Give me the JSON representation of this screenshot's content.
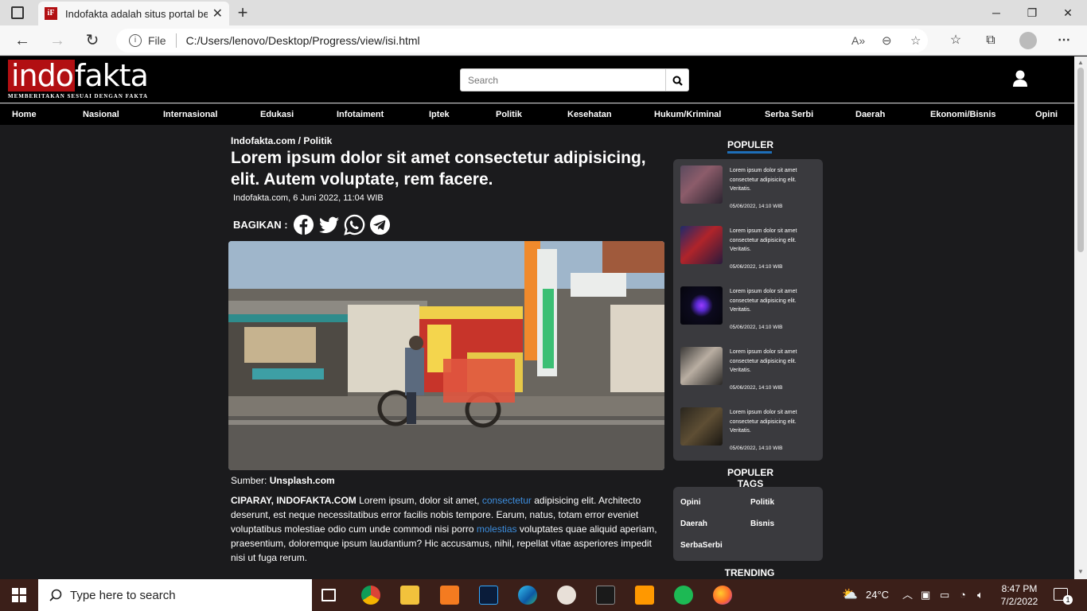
{
  "browser": {
    "tab_title": "Indofakta adalah situs portal beri",
    "url_prefix": "File",
    "url": "C:/Users/lenovo/Desktop/Progress/view/isi.html"
  },
  "site": {
    "logo_left": "indo",
    "logo_right": "fakta",
    "logo_tagline": "MEMBERITAKAN SESUAI DENGAN FAKTA",
    "search_placeholder": "Search",
    "nav": [
      "Home",
      "Nasional",
      "Internasional",
      "Edukasi",
      "Infotaiment",
      "Iptek",
      "Politik",
      "Kesehatan",
      "Hukum/Kriminal",
      "Serba Serbi",
      "Daerah",
      "Ekonomi/Bisnis",
      "Opini"
    ]
  },
  "article": {
    "breadcrumb": "Indofakta.com / Politik",
    "title": "Lorem ipsum dolor sit amet consectetur adipisicing, elit. Autem voluptate, rem facere.",
    "dateline": "Indofakta.com, 6 Juni 2022, 11:04 WIB",
    "share_label": "BAGIKAN :",
    "share_icons": [
      "facebook-icon",
      "twitter-icon",
      "whatsapp-icon",
      "telegram-icon"
    ],
    "source_label": "Sumber:",
    "source_value": "Unsplash.com",
    "body_lead": "CIPARAY, INDOFAKTA.COM",
    "body_1": " Lorem ipsum, dolor sit amet, ",
    "body_link_1": "consectetur",
    "body_2": " adipisicing elit. Architecto deserunt, est neque necessitatibus error facilis nobis tempore. Earum, natus, totam error eveniet voluptatibus molestiae odio cum unde commodi nisi porro ",
    "body_link_2": "molestias",
    "body_3": " voluptates quae aliquid aperiam, praesentium, doloremque ipsum laudantium? Hic accusamus, nihil, repellat vitae asperiores impedit nisi ut fuga rerum."
  },
  "sidebar": {
    "popular_title": "POPULER",
    "popular": [
      {
        "text": "Lorem ipsum dolor sit amet consectetur adipisicing elit. Veritatis.",
        "date": "05/06/2022, 14:10 WIB"
      },
      {
        "text": "Lorem ipsum dolor sit amet consectetur adipisicing elit. Veritatis.",
        "date": "05/06/2022, 14:10 WIB"
      },
      {
        "text": "Lorem ipsum dolor sit amet consectetur adipisicing elit. Veritatis.",
        "date": "05/06/2022, 14:10 WIB"
      },
      {
        "text": "Lorem ipsum dolor sit amet consectetur adipisicing elit. Veritatis.",
        "date": "05/06/2022, 14:10 WIB"
      },
      {
        "text": "Lorem ipsum dolor sit amet consectetur adipisicing elit. Veritatis.",
        "date": "05/06/2022, 14:10 WIB"
      }
    ],
    "tags_title": "POPULER TAGS",
    "tags": [
      "Opini",
      "Politik",
      "Daerah",
      "Bisnis",
      "SerbaSerbi"
    ],
    "trending_title": "TRENDING"
  },
  "taskbar": {
    "search_placeholder": "Type here to search",
    "weather": "24°C",
    "time": "8:47 PM",
    "date": "7/2/2022",
    "notification_count": "1"
  },
  "colors": {
    "brand_red": "#b20f12",
    "accent_blue": "#1e6eb8",
    "link_blue": "#3d8ede",
    "page_bg": "#1b1b1d",
    "card_bg": "#3a3a3e"
  }
}
